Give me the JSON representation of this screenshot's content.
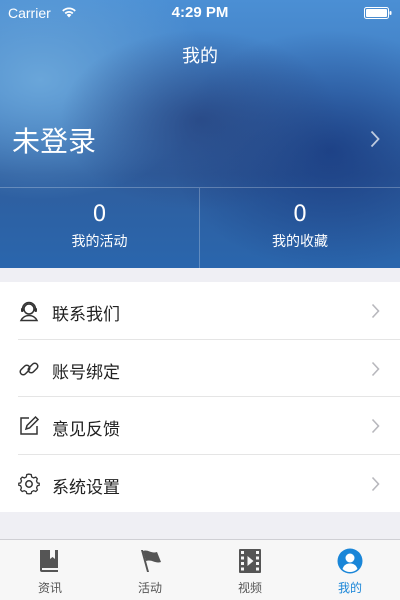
{
  "status_bar": {
    "carrier": "Carrier",
    "time": "4:29 PM"
  },
  "header": {
    "title": "我的",
    "login_text": "未登录",
    "stats": [
      {
        "count": "0",
        "label": "我的活动"
      },
      {
        "count": "0",
        "label": "我的收藏"
      }
    ]
  },
  "menu": {
    "items": [
      {
        "label": "联系我们",
        "icon": "contact-icon"
      },
      {
        "label": "账号绑定",
        "icon": "link-icon"
      },
      {
        "label": "意见反馈",
        "icon": "edit-icon"
      },
      {
        "label": "系统设置",
        "icon": "gear-icon"
      }
    ]
  },
  "tabbar": {
    "active_color": "#1a86d8",
    "items": [
      {
        "label": "资讯",
        "icon": "book-icon"
      },
      {
        "label": "活动",
        "icon": "flag-icon"
      },
      {
        "label": "视频",
        "icon": "film-icon"
      },
      {
        "label": "我的",
        "icon": "user-icon",
        "active": true
      }
    ]
  }
}
